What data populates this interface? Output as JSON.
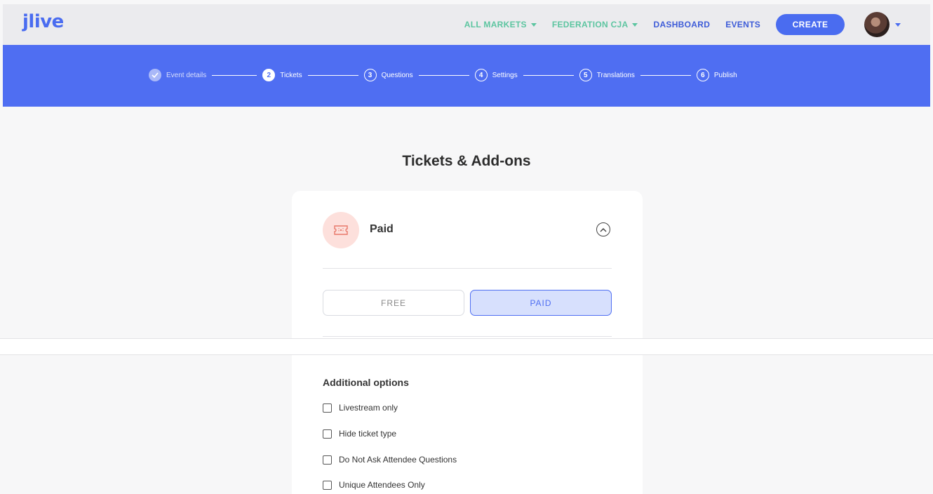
{
  "app": {
    "logo": "jlive"
  },
  "nav": {
    "markets": "ALL MARKETS",
    "federation": "FEDERATION CJA",
    "dashboard": "DASHBOARD",
    "events": "EVENTS",
    "create": "CREATE"
  },
  "steps": [
    {
      "number": "",
      "label": "Event details",
      "state": "done"
    },
    {
      "number": "2",
      "label": "Tickets",
      "state": "active"
    },
    {
      "number": "3",
      "label": "Questions",
      "state": "pending"
    },
    {
      "number": "4",
      "label": "Settings",
      "state": "pending"
    },
    {
      "number": "5",
      "label": "Translations",
      "state": "pending"
    },
    {
      "number": "6",
      "label": "Publish",
      "state": "pending"
    }
  ],
  "page": {
    "title": "Tickets & Add-ons"
  },
  "ticket": {
    "type_label": "Paid",
    "free_label": "FREE",
    "paid_label": "PAID",
    "selected": "PAID"
  },
  "options": {
    "title": "Additional options",
    "items": [
      {
        "label": "Livestream only",
        "checked": false
      },
      {
        "label": "Hide ticket type",
        "checked": false
      },
      {
        "label": "Do Not Ask Attendee Questions",
        "checked": false
      },
      {
        "label": "Unique Attendees Only",
        "checked": false
      }
    ]
  },
  "colors": {
    "brand": "#4f6ef2",
    "accent_green": "#5cc5a0",
    "ticket_badge": "#fde0dc"
  }
}
